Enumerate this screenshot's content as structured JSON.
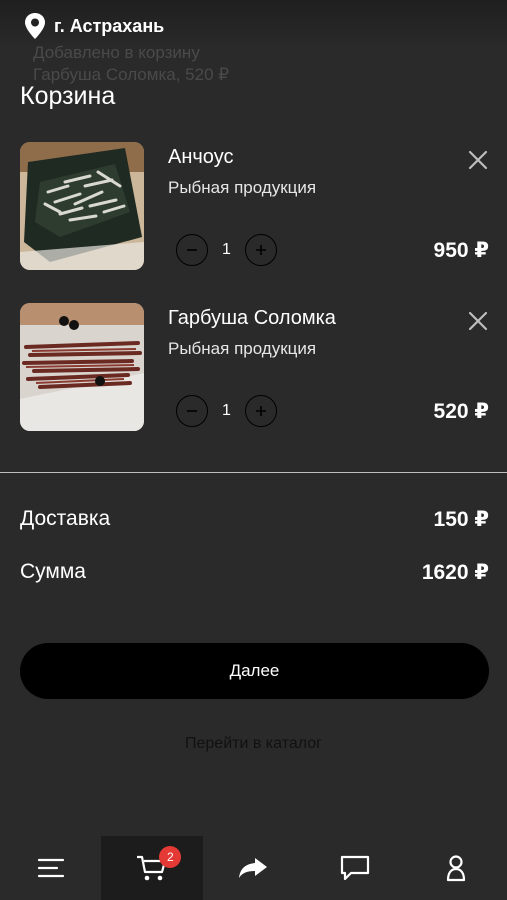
{
  "header": {
    "city": "г. Астрахань",
    "toast_line1": "Добавлено в корзину",
    "toast_line2": "Гарбуша Соломка, 520 ₽"
  },
  "page": {
    "title": "Корзина"
  },
  "cart": {
    "items": [
      {
        "name": "Анчоус",
        "category": "Рыбная продукция",
        "quantity": "1",
        "price": "950 ₽"
      },
      {
        "name": "Гарбуша Соломка",
        "category": "Рыбная продукция",
        "quantity": "1",
        "price": "520 ₽"
      }
    ]
  },
  "summary": {
    "delivery_label": "Доставка",
    "delivery_value": "150 ₽",
    "total_label": "Сумма",
    "total_value": "1620 ₽"
  },
  "actions": {
    "next_label": "Далее",
    "catalog_link": "Перейти в каталог"
  },
  "tabbar": {
    "items": [
      {
        "icon": "menu-icon"
      },
      {
        "icon": "cart-icon",
        "badge": "2",
        "active": true
      },
      {
        "icon": "share-icon"
      },
      {
        "icon": "chat-icon"
      },
      {
        "icon": "profile-icon"
      }
    ]
  },
  "colors": {
    "background": "#2a2a2a",
    "button": "#000000",
    "badge": "#e53935",
    "divider": "#bdbdbd"
  }
}
